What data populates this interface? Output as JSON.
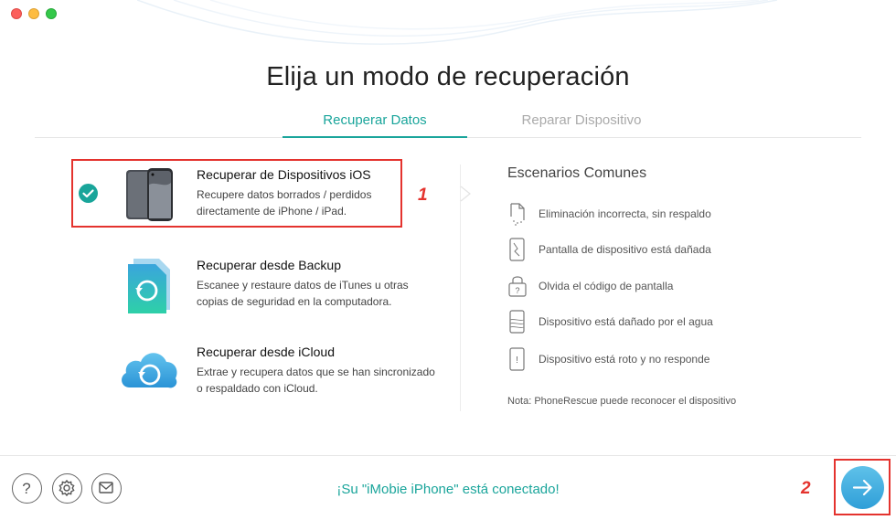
{
  "window": {
    "controls": [
      "close",
      "minimize",
      "zoom"
    ]
  },
  "page_title": "Elija un modo de recuperación",
  "tabs": [
    {
      "label": "Recuperar Datos",
      "active": true
    },
    {
      "label": "Reparar Dispositivo",
      "active": false
    }
  ],
  "modes": [
    {
      "title": "Recuperar de Dispositivos iOS",
      "desc_line1": "Recupere datos borrados / perdidos",
      "desc_line2": "directamente de iPhone / iPad.",
      "selected": true,
      "icon": "ios-devices-icon"
    },
    {
      "title": "Recuperar desde Backup",
      "desc_line1": "Escanee y restaure datos de iTunes u otras",
      "desc_line2": "copias de seguridad en la computadora.",
      "selected": false,
      "icon": "backup-file-icon"
    },
    {
      "title": "Recuperar desde iCloud",
      "desc_line1": "Extrae y recupera datos que se han sincronizado",
      "desc_line2": "o respaldado con iCloud.",
      "selected": false,
      "icon": "icloud-icon"
    }
  ],
  "callouts": {
    "first": "1",
    "second": "2"
  },
  "scenarios": {
    "title": "Escenarios Comunes",
    "items": [
      {
        "label": "Eliminación incorrecta, sin respaldo",
        "icon": "deleted-file-icon"
      },
      {
        "label": "Pantalla de dispositivo está dañada",
        "icon": "broken-screen-icon"
      },
      {
        "label": "Olvida el código de pantalla",
        "icon": "locked-icon"
      },
      {
        "label": "Dispositivo está dañado por el agua",
        "icon": "water-damage-icon"
      },
      {
        "label": "Dispositivo está roto y no responde",
        "icon": "unresponsive-device-icon"
      }
    ],
    "note": "Nota: PhoneRescue puede reconocer el dispositivo"
  },
  "footer": {
    "help_label": "?",
    "status": "¡Su \"iMobie iPhone\" está conectado!"
  },
  "colors": {
    "accent": "#1aa59b",
    "highlight": "#e4332e",
    "next": "#3aa8de"
  }
}
